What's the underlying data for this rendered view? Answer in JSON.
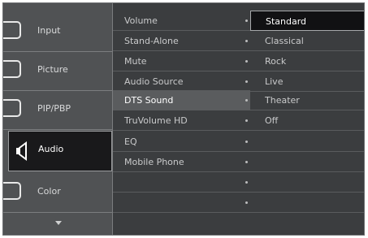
{
  "sidebar": {
    "items": [
      {
        "label": "Input",
        "icon": "input-icon"
      },
      {
        "label": "Picture",
        "icon": "picture-icon"
      },
      {
        "label": "PIP/PBP",
        "icon": "pip-icon"
      },
      {
        "label": "Audio",
        "icon": "speaker-icon"
      },
      {
        "label": "Color",
        "icon": "color-icon"
      }
    ],
    "active_index": 3
  },
  "audio_menu": {
    "items": [
      "Volume",
      "Stand-Alone",
      "Mute",
      "Audio Source",
      "DTS Sound",
      "TruVolume HD",
      "EQ",
      "Mobile Phone"
    ],
    "highlighted_index": 4
  },
  "dts_options": {
    "items": [
      "Standard",
      "Classical",
      "Rock",
      "Live",
      "Theater",
      "Off"
    ],
    "selected_index": 0
  },
  "colors": {
    "background": "#3b3d3f",
    "sidebar": "#505254",
    "selected": "#111113",
    "highlight": "#5a5c5e"
  }
}
